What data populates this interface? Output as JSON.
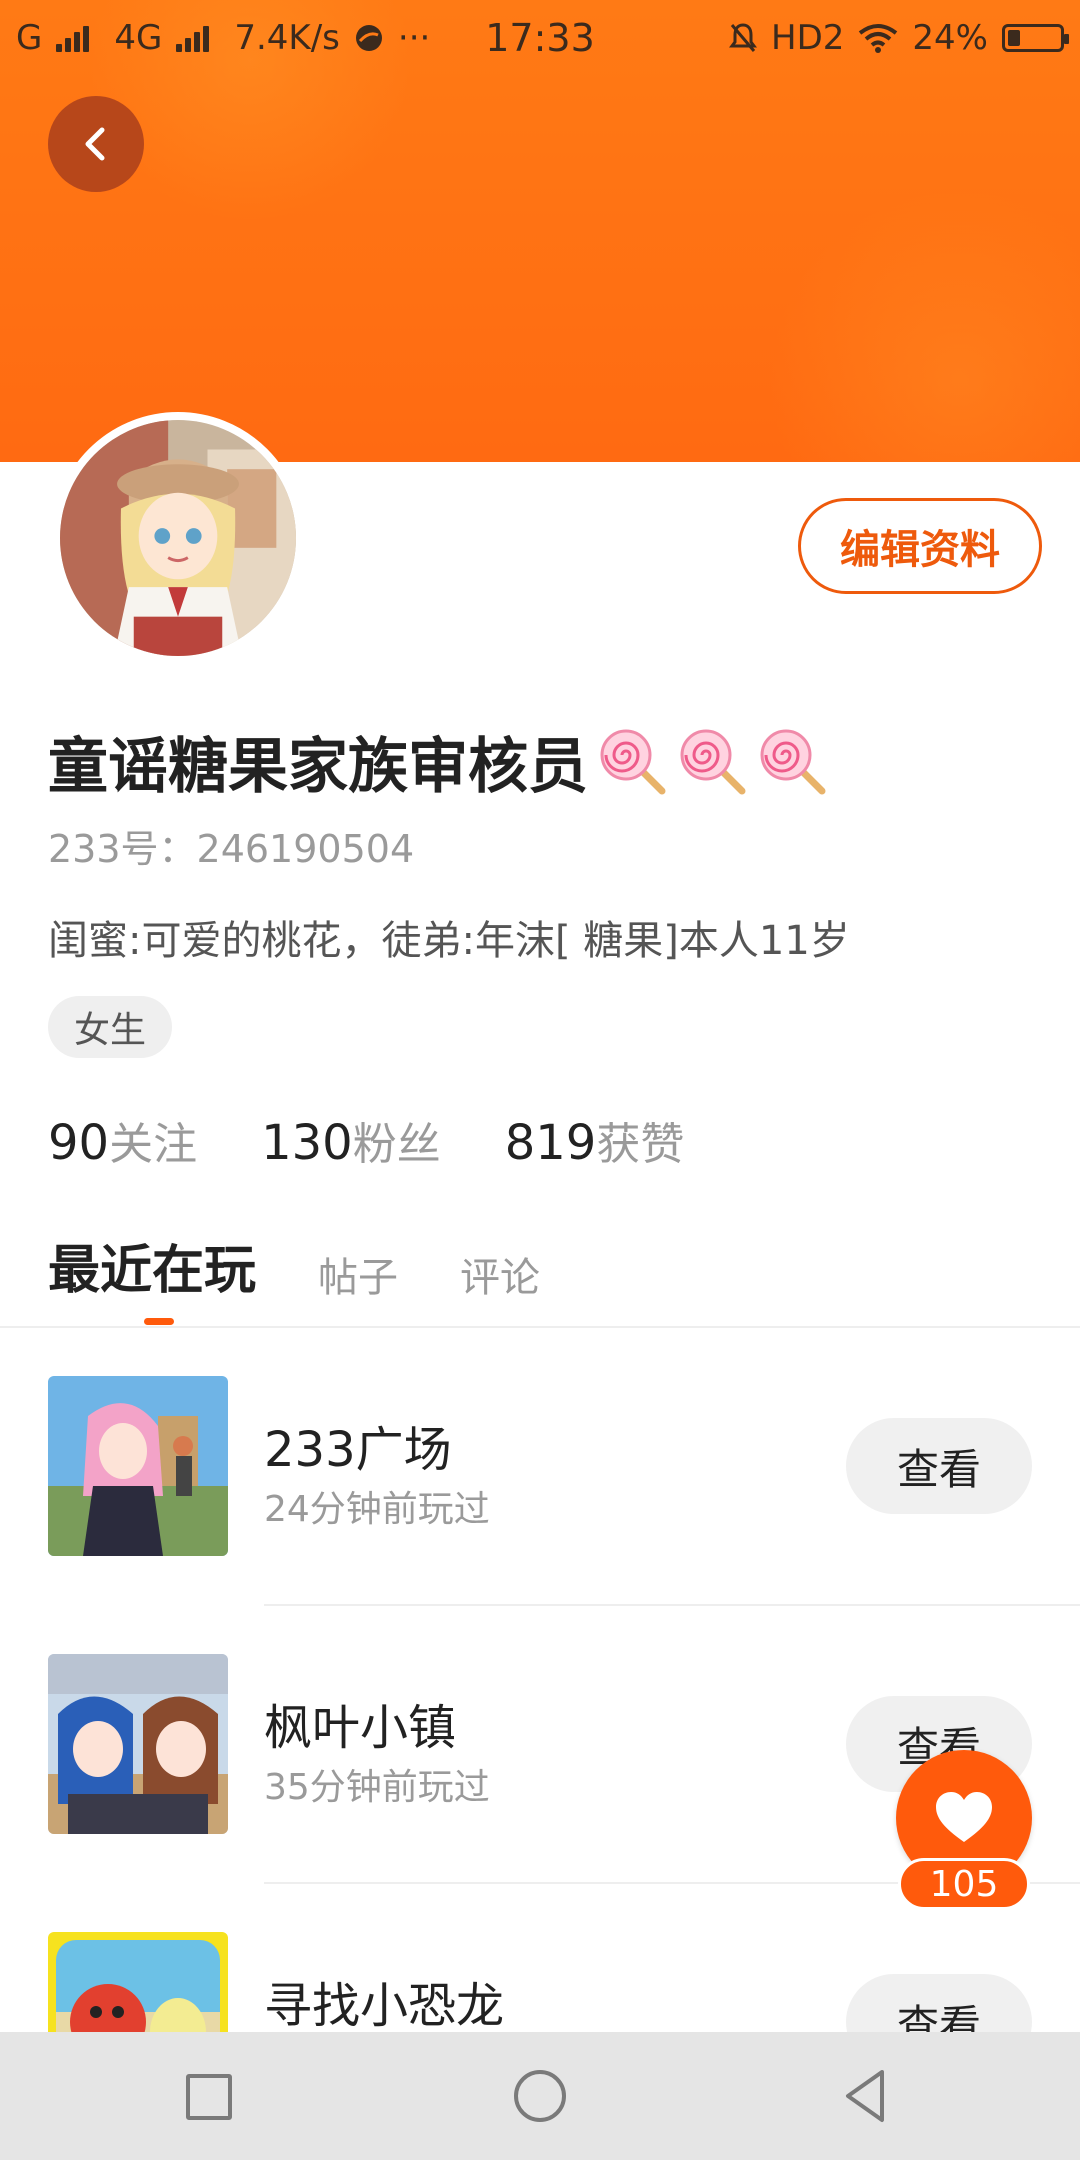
{
  "status_bar": {
    "network_left": "G",
    "network_4g": "4G",
    "speed": "7.4K/s",
    "more": "···",
    "time": "17:33",
    "hd": "HD2",
    "battery_percent": "24%",
    "battery_level": 0.24
  },
  "profile": {
    "nickname": "童谣糖果家族审核员",
    "lollipop_count": 3,
    "account_id": "233号：246190504",
    "bio": "闺蜜:可爱的桃花，徒弟:年沫[ 糖果]本人11岁",
    "gender_tag": "女生",
    "edit_label": "编辑资料"
  },
  "stats": [
    {
      "num": "90",
      "label": "关注"
    },
    {
      "num": "130",
      "label": "粉丝"
    },
    {
      "num": "819",
      "label": "获赞"
    }
  ],
  "tabs": [
    {
      "label": "最近在玩",
      "active": true
    },
    {
      "label": "帖子",
      "active": false
    },
    {
      "label": "评论",
      "active": false
    }
  ],
  "games": [
    {
      "title": "233广场",
      "subtitle": "24分钟前玩过",
      "button": "查看"
    },
    {
      "title": "枫叶小镇",
      "subtitle": "35分钟前玩过",
      "button": "查看"
    },
    {
      "title": "寻找小恐龙",
      "subtitle": "",
      "button": "查看"
    }
  ],
  "like_fab": {
    "count": "105"
  },
  "colors": {
    "accent": "#ff5a0c",
    "header": "#ff7a15"
  },
  "icons": [
    "back-arrow-icon",
    "heart-icon",
    "lollipop-icon",
    "square-nav-icon",
    "circle-nav-icon",
    "triangle-back-nav-icon"
  ]
}
